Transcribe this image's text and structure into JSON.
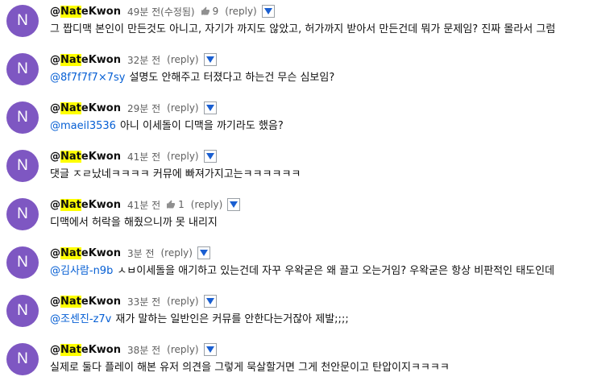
{
  "comments": [
    {
      "avatar": "N",
      "author_prefix": "@",
      "author_hl": "Nat",
      "author_suffix": "eKwon",
      "time": "49분 전(수정됨)",
      "likes": "9",
      "reply": "(reply)",
      "mention": "",
      "text": "그 짭디맥 본인이 만든것도 아니고, 자기가 까지도 않았고, 허가까지 받아서 만든건데 뭐가 문제임? 진짜 몰라서 그럼"
    },
    {
      "avatar": "N",
      "author_prefix": "@",
      "author_hl": "Nat",
      "author_suffix": "eKwon",
      "time": "32분 전",
      "likes": "",
      "reply": "(reply)",
      "mention": "@8f7f7f7×7sy",
      "text": "설명도 안해주고 터졌다고 하는건 무슨 심보임?"
    },
    {
      "avatar": "N",
      "author_prefix": "@",
      "author_hl": "Nat",
      "author_suffix": "eKwon",
      "time": "29분 전",
      "likes": "",
      "reply": "(reply)",
      "mention": "@maeil3536",
      "text": "아니 이세돌이 디맥을 까기라도 했음?"
    },
    {
      "avatar": "N",
      "author_prefix": "@",
      "author_hl": "Nat",
      "author_suffix": "eKwon",
      "time": "41분 전",
      "likes": "",
      "reply": "(reply)",
      "mention": "",
      "text": "댓글 ㅈㄹ났네ㅋㅋㅋㅋ 커뮤에 빠져가지고는ㅋㅋㅋㅋㅋㅋ"
    },
    {
      "avatar": "N",
      "author_prefix": "@",
      "author_hl": "Nat",
      "author_suffix": "eKwon",
      "time": "41분 전",
      "likes": "1",
      "reply": "(reply)",
      "mention": "",
      "text": "디맥에서 허락을 해줬으니까 못 내리지"
    },
    {
      "avatar": "N",
      "author_prefix": "@",
      "author_hl": "Nat",
      "author_suffix": "eKwon",
      "time": "3분 전",
      "likes": "",
      "reply": "(reply)",
      "mention": "@김사람-n9b",
      "text": "ㅅㅂ이세돌을 애기하고 있는건데 자꾸 우왁굳은 왜 끌고 오는거임? 우왁굳은 항상 비판적인 태도인데"
    },
    {
      "avatar": "N",
      "author_prefix": "@",
      "author_hl": "Nat",
      "author_suffix": "eKwon",
      "time": "33분 전",
      "likes": "",
      "reply": "(reply)",
      "mention": "@조센진-z7v",
      "text": "재가 말하는 일반인은 커뮤를 안한다는거잖아 제발;;;;"
    },
    {
      "avatar": "N",
      "author_prefix": "@",
      "author_hl": "Nat",
      "author_suffix": "eKwon",
      "time": "38분 전",
      "likes": "",
      "reply": "(reply)",
      "mention": "",
      "text": "실제로 둘다 플레이 해본 유저 의견을 그렇게 묵살할거면 그게 천안문이고 탄압이지ㅋㅋㅋㅋ"
    }
  ],
  "colors": {
    "avatar": "#7e57c2",
    "mention": "#065fd4",
    "highlight": "#ffff00",
    "dropdown_arrow": "#1a5fd1"
  },
  "icons": {
    "like": "thumb-up-icon",
    "dropdown": "dropdown-arrow-icon"
  }
}
